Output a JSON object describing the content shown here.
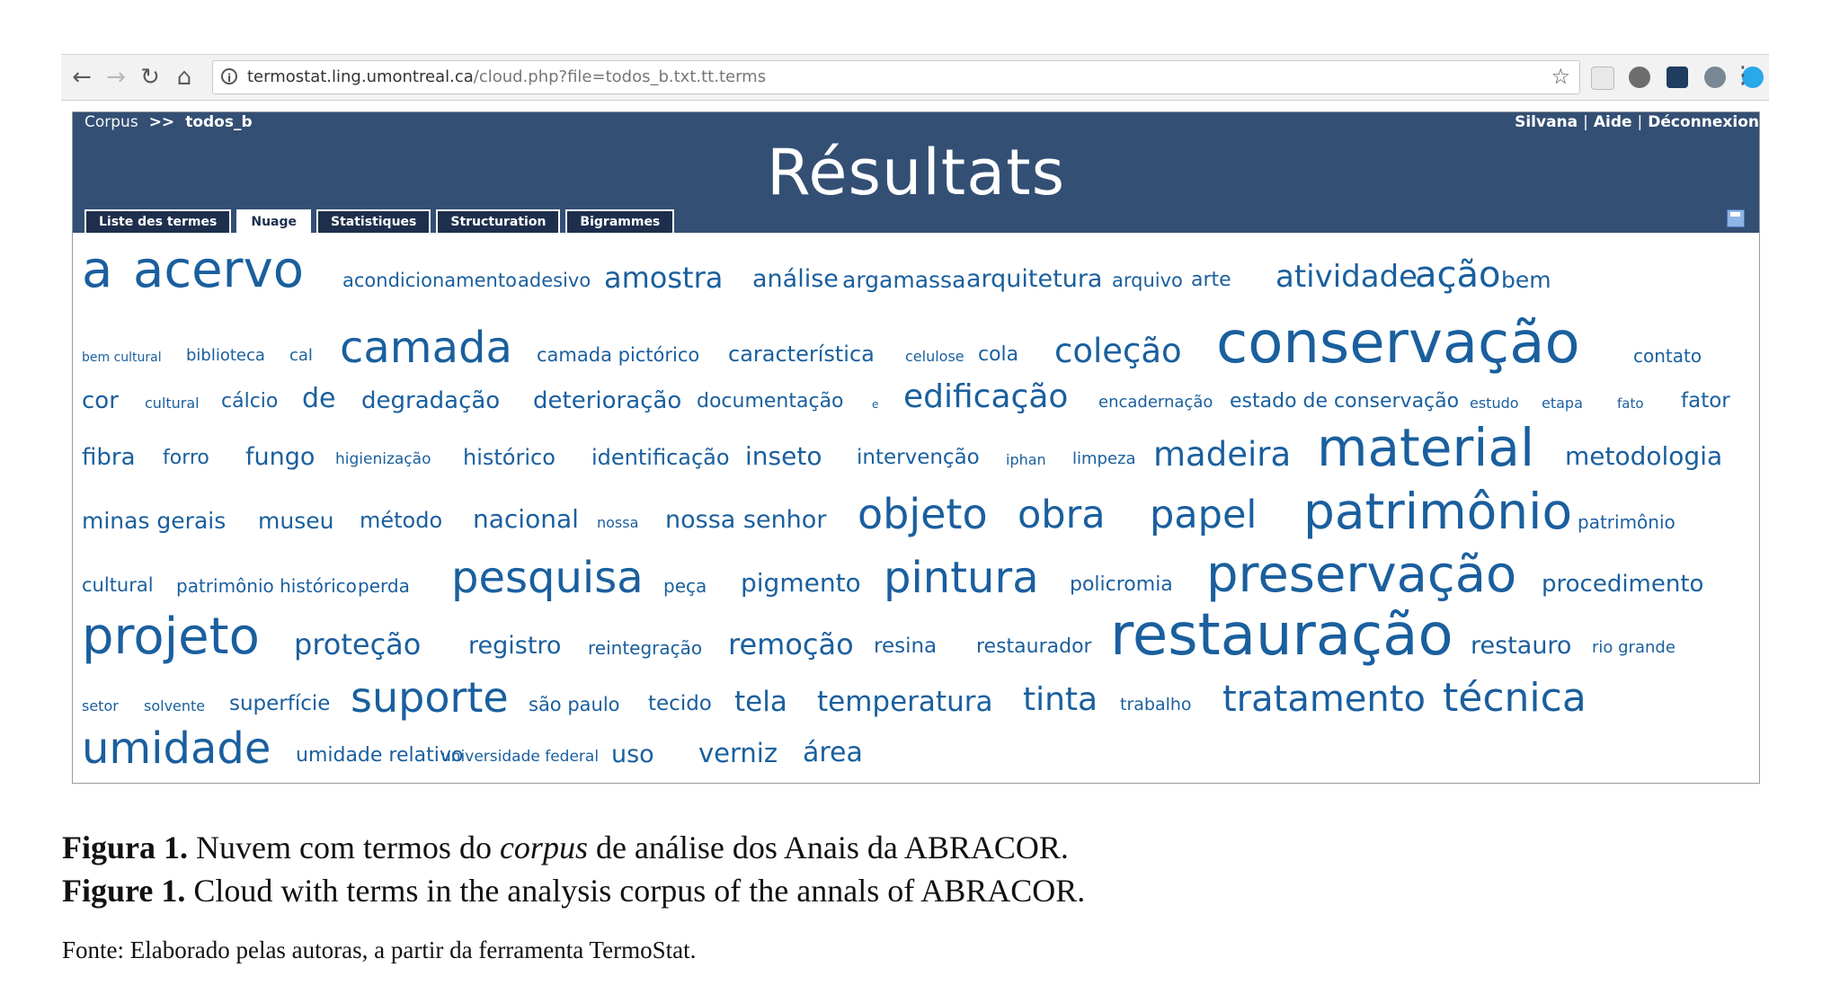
{
  "browser": {
    "url_host": "termostat.ling.umontreal.ca",
    "url_path": "/cloud.php?file=todos_b.txt.tt.terms",
    "back_icon": "←",
    "forward_icon": "→",
    "reload_icon": "↻",
    "home_icon": "⌂",
    "info_icon": "i",
    "star_icon": "☆",
    "menu_icon": "⋮"
  },
  "header": {
    "crumb_label": "Corpus",
    "crumb_sep": ">>",
    "crumb_current": "todos_b",
    "user": "Silvana",
    "sep": "|",
    "help": "Aide",
    "logout": "Déconnexion",
    "title": "Résultats",
    "tabs": [
      {
        "label": "Liste des termes"
      },
      {
        "label": "Nuage"
      },
      {
        "label": "Statistiques"
      },
      {
        "label": "Structuration"
      },
      {
        "label": "Bigrammes"
      }
    ],
    "colors": {
      "header_bg": "#344f74",
      "tab_bg": "#1d2f4c",
      "word": "#1a5f9e"
    }
  },
  "cloud_words": [
    "a",
    "acervo",
    "acondicionamento",
    "adesivo",
    "amostra",
    "análise",
    "argamassa",
    "arquitetura",
    "arquivo",
    "arte",
    "atividade",
    "ação",
    "bem",
    "bem cultural",
    "biblioteca",
    "cal",
    "camada",
    "camada pictórico",
    "característica",
    "celulose",
    "cola",
    "coleção",
    "conservação",
    "contato",
    "cor",
    "cultural",
    "cálcio",
    "de",
    "degradação",
    "deterioração",
    "documentação",
    "e",
    "edificação",
    "encadernação",
    "estado de conservação",
    "estudo",
    "etapa",
    "fato",
    "fator",
    "fibra",
    "forro",
    "fungo",
    "higienização",
    "histórico",
    "identificação",
    "inseto",
    "intervenção",
    "iphan",
    "limpeza",
    "madeira",
    "material",
    "metodologia",
    "minas gerais",
    "museu",
    "método",
    "nacional",
    "nossa",
    "nossa senhor",
    "objeto",
    "obra",
    "papel",
    "patrimônio",
    "patrimônio",
    "cultural",
    "patrimônio histórico",
    "perda",
    "pesquisa",
    "peça",
    "pigmento",
    "pintura",
    "policromia",
    "preservação",
    "procedimento",
    "projeto",
    "proteção",
    "registro",
    "reintegração",
    "remoção",
    "resina",
    "restaurador",
    "restauração",
    "restauro",
    "rio grande",
    "setor",
    "solvente",
    "superfície",
    "suporte",
    "são paulo",
    "tecido",
    "tela",
    "temperatura",
    "tinta",
    "trabalho",
    "tratamento",
    "técnica",
    "umidade",
    "umidade relativo",
    "universidade federal",
    "uso",
    "verniz",
    "área"
  ],
  "caption": {
    "fig_pt_label": "Figura 1.",
    "fig_pt_text_a": " Nuvem com termos do ",
    "fig_pt_italic": "corpus",
    "fig_pt_text_b": " de análise dos Anais da ABRACOR.",
    "fig_en_label": "Figure 1.",
    "fig_en_text": " Cloud with terms in the analysis corpus of the annals of ABRACOR.",
    "source": "Fonte: Elaborado pelas autoras, a partir da ferramenta TermoStat."
  }
}
